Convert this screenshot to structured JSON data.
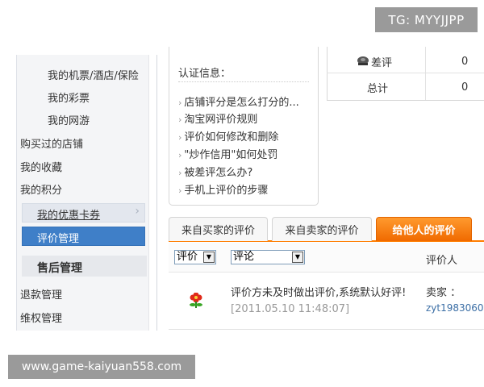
{
  "watermarks": {
    "top": "TG: MYYJJPP",
    "bottom": "www.game-kaiyuan558.com"
  },
  "sidebar": {
    "items": [
      "我的机票/酒店/保险",
      "我的彩票",
      "我的网游",
      "购买过的店铺",
      "我的收藏",
      "我的积分"
    ],
    "coupon": "我的优惠卡券",
    "active": "评价管理",
    "section": "售后管理",
    "after_sales": [
      "退款管理",
      "维权管理"
    ]
  },
  "info": {
    "title": "认证信息：",
    "links": [
      "店铺评分是怎么打分的...",
      "淘宝网评价规则",
      "评价如何修改和删除",
      "\"炒作信用\"如何处罚",
      "被差评怎么办?",
      "手机上评价的步骤"
    ]
  },
  "stats": {
    "bad_label": "差评",
    "bad_value": "0",
    "total_label": "总计",
    "total_value": "0"
  },
  "tabs": {
    "from_buyer": "来自买家的评价",
    "from_seller": "来自卖家的评价",
    "to_others": "给他人的评价"
  },
  "filters": {
    "rating": "评价",
    "comment": "评论",
    "evaluator_header": "评价人"
  },
  "review": {
    "text": "评价方未及时做出评价,系统默认好评!",
    "time": "[2011.05.10 11:48:07]",
    "seller_label": "卖家 ：",
    "seller_name": "zyt1983060"
  },
  "colors": {
    "accent": "#ff7e00",
    "active_nav": "#3f7fc8",
    "link": "#3b6ea5"
  }
}
